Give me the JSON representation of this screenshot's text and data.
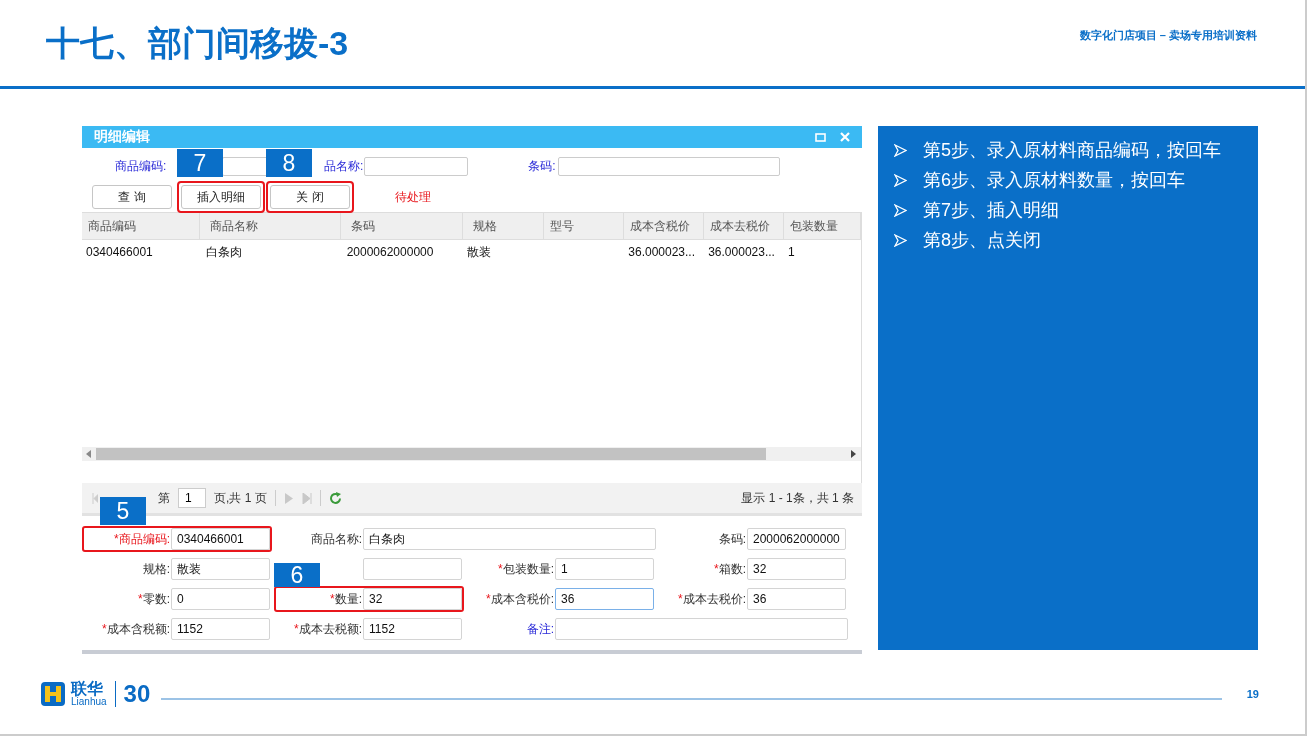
{
  "header": {
    "title": "十七、部门间移拨-3",
    "subtitle": "数字化门店项目 – 卖场专用培训资料"
  },
  "window": {
    "title": "明细编辑"
  },
  "filters": [
    {
      "label": "商品编码:"
    },
    {
      "label": "品名称:"
    },
    {
      "label": "条码:"
    }
  ],
  "buttons": [
    {
      "label": "查 询",
      "highlighted": false
    },
    {
      "label": "插入明细",
      "highlighted": true,
      "callout": "7"
    },
    {
      "label": "关 闭",
      "highlighted": true,
      "callout": "8"
    }
  ],
  "status": "待处理",
  "table": {
    "columns": [
      "商品编码",
      "商品名称",
      "条码",
      "规格",
      "型号",
      "成本含税价",
      "成本去税价",
      "包装数量"
    ],
    "rows": [
      [
        "0340466001",
        "白条肉",
        "2000062000000",
        "散装",
        null,
        "36.000023...",
        "36.000023...",
        "1"
      ]
    ]
  },
  "pager": {
    "prefix": "第",
    "page": "1",
    "suffix": "页,共 1 页",
    "summary": "显示 1 - 1条，共 1 条"
  },
  "form": {
    "fields": [
      {
        "mark": "*",
        "label": "商品编码:",
        "value": "0340466001",
        "kind": "key",
        "highlighted": true,
        "wide": false,
        "callout": "5"
      },
      {
        "label": "商品名称:",
        "value": "白条肉",
        "kind": "plain",
        "highlighted": false,
        "wide": true
      },
      {
        "label": "条码:",
        "value": "2000062000000",
        "kind": "plain",
        "highlighted": false,
        "wide": false
      },
      {
        "label": "规格:",
        "value": "散装",
        "kind": "plain",
        "highlighted": false,
        "wide": false
      },
      {
        "kind": "plain",
        "highlighted": false,
        "wide": false
      },
      {
        "mark": "*",
        "label": "包装数量:",
        "value": "1",
        "kind": "plain",
        "highlighted": false,
        "wide": false
      },
      {
        "mark": "*",
        "label": "箱数:",
        "value": "32",
        "kind": "plain",
        "highlighted": false,
        "wide": false
      },
      {
        "mark": "*",
        "label": "零数:",
        "value": "0",
        "kind": "plain",
        "highlighted": false,
        "wide": false
      },
      {
        "mark": "*",
        "label": "数量:",
        "value": "32",
        "kind": "plain",
        "highlighted": true,
        "wide": false,
        "callout": "6"
      },
      {
        "mark": "*",
        "label": "成本含税价:",
        "value": "36",
        "kind": "plain",
        "highlighted": false,
        "wide": false,
        "focused": true
      },
      {
        "mark": "*",
        "label": "成本去税价:",
        "value": "36",
        "kind": "plain",
        "highlighted": false,
        "wide": false
      },
      {
        "mark": "*",
        "label": "成本含税额:",
        "value": "1152",
        "kind": "plain",
        "highlighted": false,
        "wide": false
      },
      {
        "mark": "*",
        "label": "成本去税额:",
        "value": "1152",
        "kind": "plain",
        "highlighted": false,
        "wide": false
      },
      {
        "label": "备注:",
        "kind": "link",
        "highlighted": false,
        "wide": true
      }
    ]
  },
  "steps": [
    "第5步、录入原材料商品编码，按回车",
    "第6步、录入原材料数量，按回车",
    "第7步、插入明细",
    "第8步、点关闭"
  ],
  "footer": {
    "brand": "联华",
    "brand_latin": "Lianhua",
    "anniversary": "30",
    "page_number": "19"
  }
}
